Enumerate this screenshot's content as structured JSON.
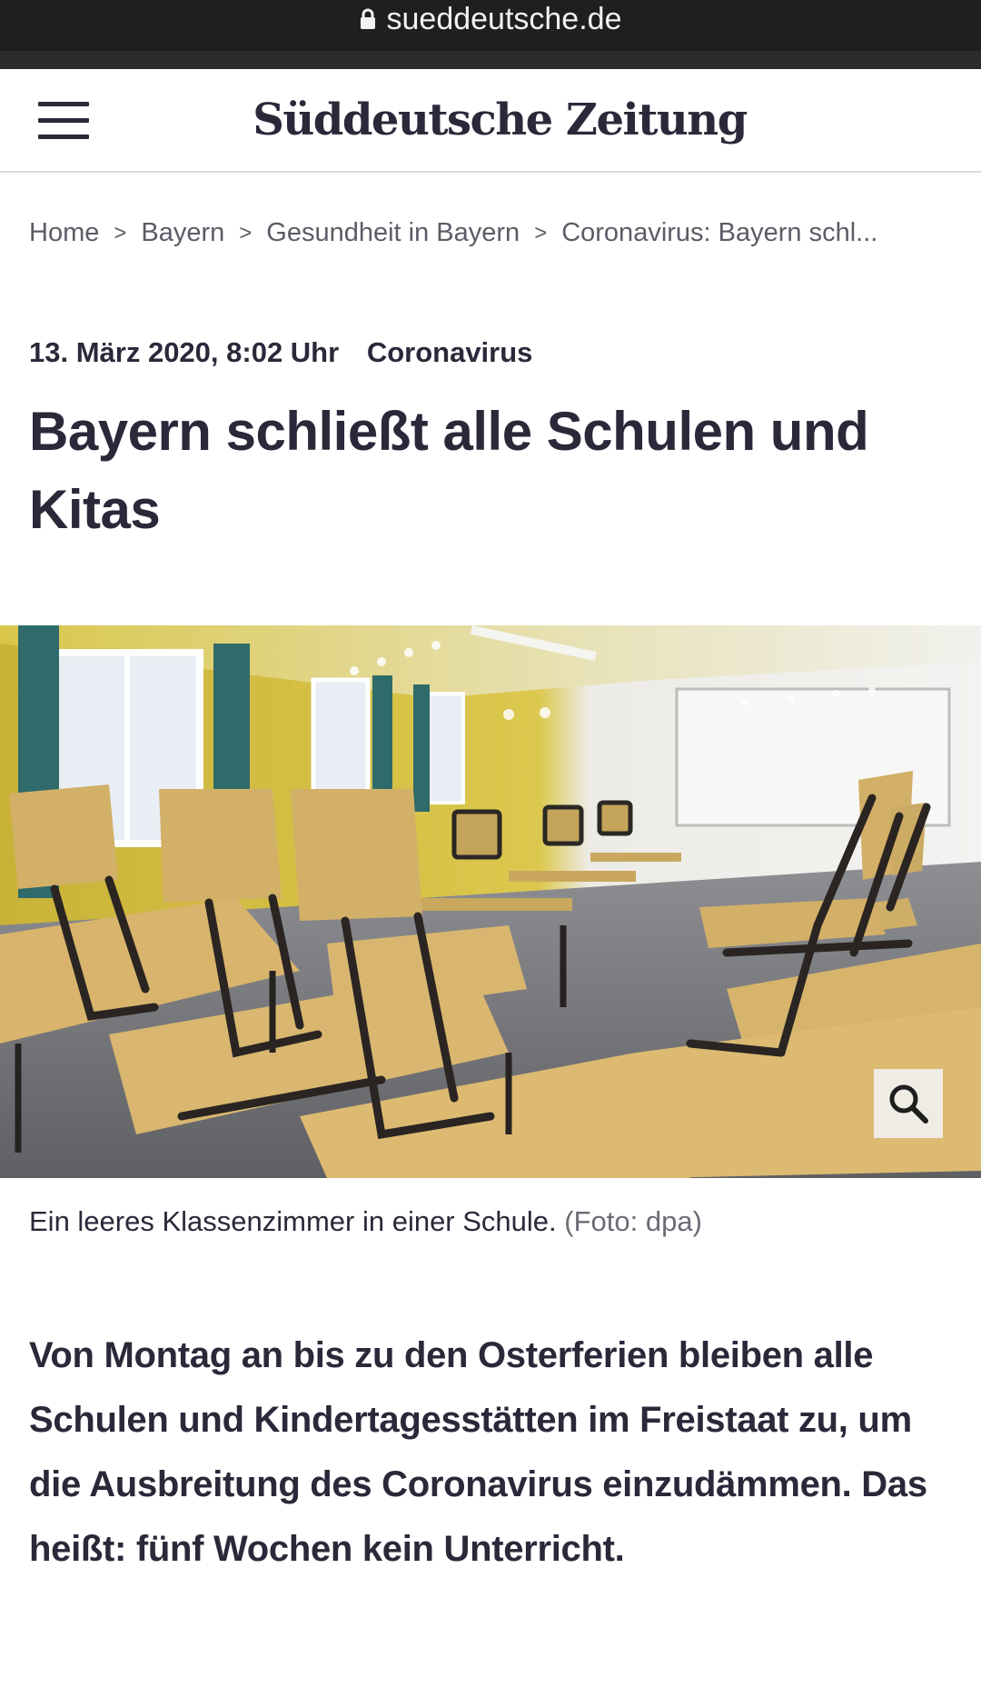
{
  "browser": {
    "url": "sueddeutsche.de"
  },
  "header": {
    "logo_text": "Süddeutsche Zeitung"
  },
  "breadcrumb": [
    "Home",
    "Bayern",
    "Gesundheit in Bayern",
    "Coronavirus: Bayern schl..."
  ],
  "article": {
    "date": "13. März 2020, 8:02 Uhr",
    "topic": "Coronavirus",
    "headline": "Bayern schließt alle Schulen und Kitas",
    "caption": "Ein leeres Klassenzimmer in einer Schule.",
    "credit": "(Foto: dpa)",
    "lead": "Von Montag an bis zu den Osterferien bleiben alle Schulen und Kindertagesstätten im Freistaat zu, um die Ausbreitung des Coronavirus einzudämmen. Das heißt: fünf Wochen kein Unterricht."
  },
  "icons": {
    "lock": "lock-icon",
    "menu": "hamburger-menu-icon",
    "zoom": "magnifier-icon"
  },
  "colors": {
    "text": "#29293a",
    "url_bar": "#1f1f21"
  }
}
